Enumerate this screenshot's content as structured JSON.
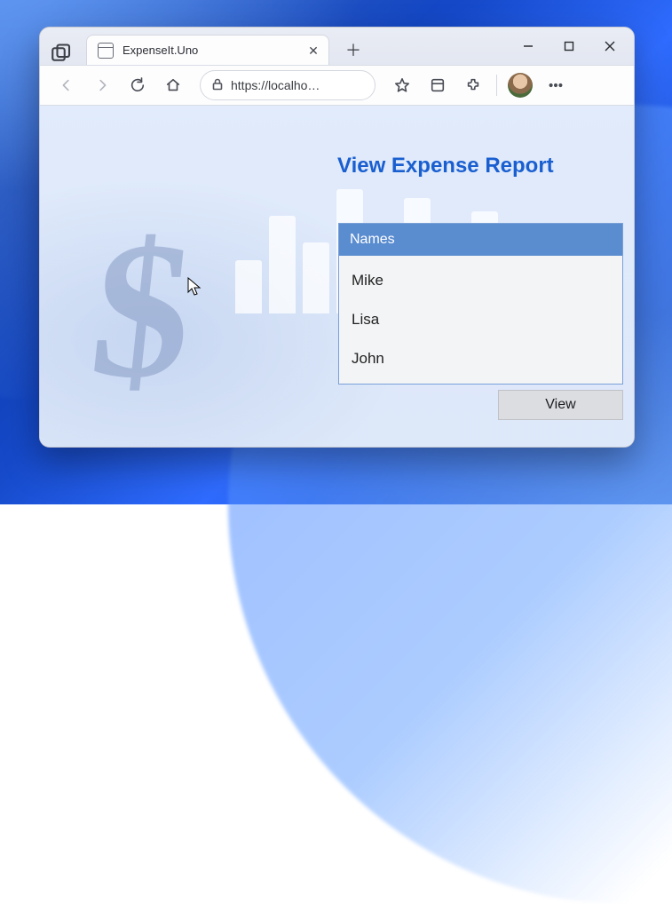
{
  "browser": {
    "tab_title": "ExpenseIt.Uno",
    "url_display": "https://localho…"
  },
  "page": {
    "title": "View Expense Report",
    "list_header": "Names",
    "names": [
      "Mike",
      "Lisa",
      "John"
    ],
    "view_button": "View"
  }
}
